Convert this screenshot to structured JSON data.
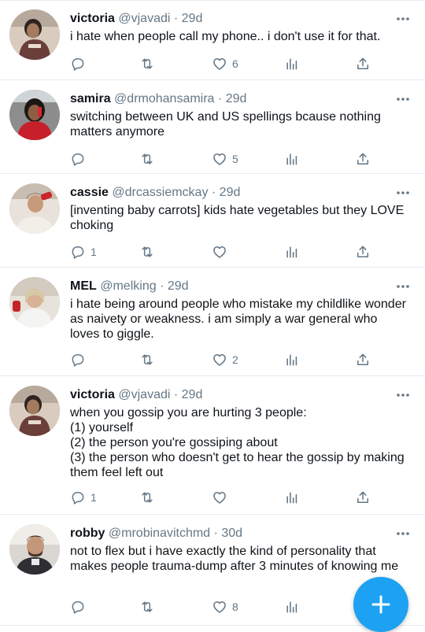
{
  "tweets": [
    {
      "name": "victoria",
      "handle": "@vjavadi",
      "dot": "·",
      "time": "29d",
      "text": "i hate when people call my phone.. i don't use it for that.",
      "reply_count": "",
      "retweet_count": "",
      "like_count": "6",
      "avatar": "victoria-avatar"
    },
    {
      "name": "samira",
      "handle": "@drmohansamira",
      "dot": "·",
      "time": "29d",
      "text": "switching between UK and US spellings bcause nothing matters anymore",
      "reply_count": "",
      "retweet_count": "",
      "like_count": "5",
      "avatar": "samira-avatar"
    },
    {
      "name": "cassie",
      "handle": "@drcassiemckay",
      "dot": "·",
      "time": "29d",
      "text": "[inventing baby carrots] kids hate vegetables but they LOVE choking",
      "reply_count": "1",
      "retweet_count": "",
      "like_count": "",
      "avatar": "cassie-avatar"
    },
    {
      "name": "MEL",
      "handle": "@melking",
      "dot": "·",
      "time": "29d",
      "text": "i hate being around people who mistake my childlike wonder as naivety or weakness. i am simply a war general who loves to giggle.",
      "reply_count": "",
      "retweet_count": "",
      "like_count": "2",
      "avatar": "mel-avatar"
    },
    {
      "name": "victoria",
      "handle": "@vjavadi",
      "dot": "·",
      "time": "29d",
      "text": "when you gossip you are hurting 3 people:\n(1) yourself\n(2) the person you're gossiping about\n(3) the person who doesn't get to hear the gossip by making them feel left out",
      "reply_count": "1",
      "retweet_count": "",
      "like_count": "",
      "avatar": "victoria-avatar"
    },
    {
      "name": "robby",
      "handle": "@mrobinavitchmd",
      "dot": "·",
      "time": "30d",
      "text": "not to flex but i have exactly the kind of personality that makes people trauma-dump after 3 minutes of knowing me",
      "reply_count": "",
      "retweet_count": "",
      "like_count": "8",
      "avatar": "robby-avatar"
    }
  ],
  "colors": {
    "accent": "#1da1f2",
    "muted": "#657786",
    "text": "#0f1419",
    "divider": "#e6ecf0"
  },
  "icons": {
    "reply": "reply-icon",
    "retweet": "retweet-icon",
    "like": "heart-icon",
    "analytics": "analytics-icon",
    "share": "share-icon",
    "more": "more-options-icon",
    "compose": "compose-tweet-icon"
  }
}
